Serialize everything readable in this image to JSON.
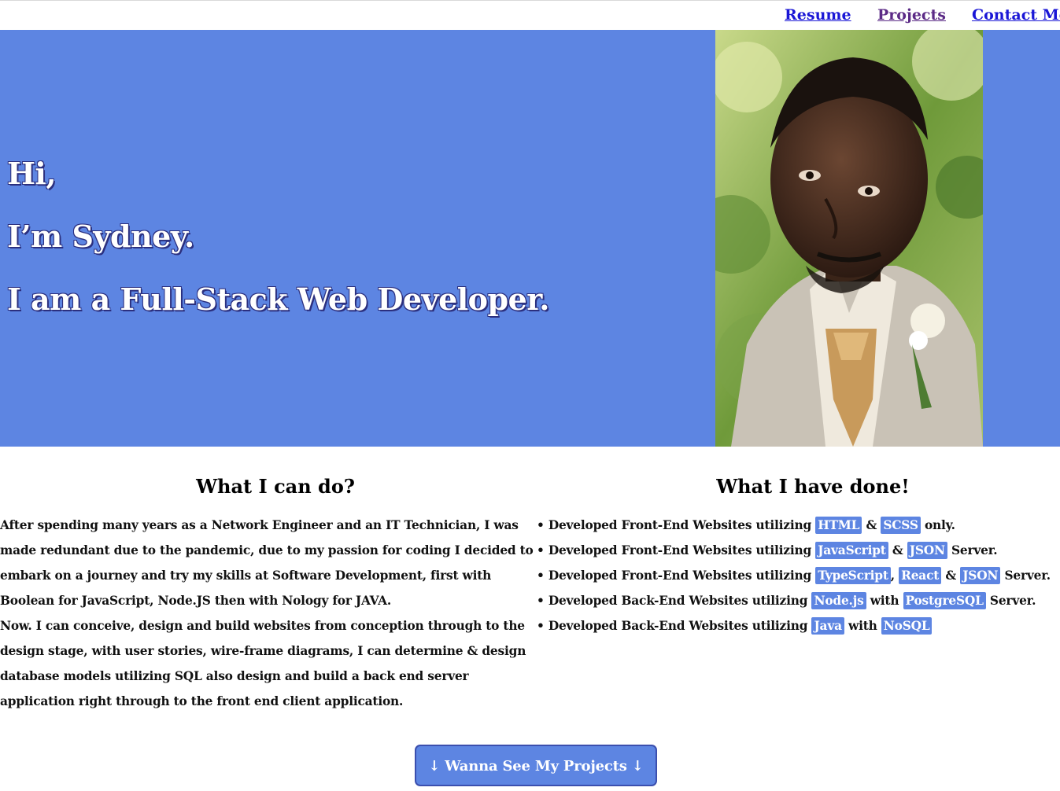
{
  "nav": {
    "resume": "Resume",
    "projects": "Projects",
    "contact": "Contact Me"
  },
  "hero": {
    "line1": "Hi,",
    "line2": "I’m Sydney.",
    "line3": "I am a Full-Stack Web Developer.",
    "background_color": "#5d85e2"
  },
  "skills": {
    "title": "What I can do?",
    "paragraph1": "After spending many years as a Network Engineer and an IT Technician, I was made redundant due to the pandemic, due to my passion for coding I decided to embark on a journey and try my skills at Software Development, first with Boolean for JavaScript, Node.JS then with Nology for JAVA.",
    "paragraph2": "Now. I can conceive, design and build websites from conception through to the design stage, with user stories, wire-frame diagrams, I can determine & design database models utilizing SQL also design and build a back end server application right through to the front end client application."
  },
  "done": {
    "title": "What I have done!",
    "items": [
      {
        "bullet": "•",
        "pre": "Developed Front-End Websites utilizing",
        "t1": "HTML",
        "j1": "&",
        "t2": "SCSS",
        "j2": "",
        "t3": "",
        "post": "only."
      },
      {
        "bullet": "•",
        "pre": "Developed Front-End Websites utilizing",
        "t1": "JavaScript",
        "j1": "&",
        "t2": "JSON",
        "j2": "",
        "t3": "",
        "post": "Server."
      },
      {
        "bullet": "•",
        "pre": "Developed Front-End Websites utilizing",
        "t1": "TypeScript",
        "j1": ",",
        "t2": "React",
        "j2": "&",
        "t3": "JSON",
        "post": "Server."
      },
      {
        "bullet": "•",
        "pre": "Developed Back-End Websites utilizing",
        "t1": "Node.js",
        "j1": "with",
        "t2": "PostgreSQL",
        "j2": "",
        "t3": "",
        "post": "Server."
      },
      {
        "bullet": "•",
        "pre": "Developed Back-End Websites utilizing",
        "t1": "Java",
        "j1": "with",
        "t2": "NoSQL",
        "j2": "",
        "t3": "",
        "post": ""
      }
    ]
  },
  "cta": {
    "label": "↓ Wanna See My Projects ↓"
  }
}
